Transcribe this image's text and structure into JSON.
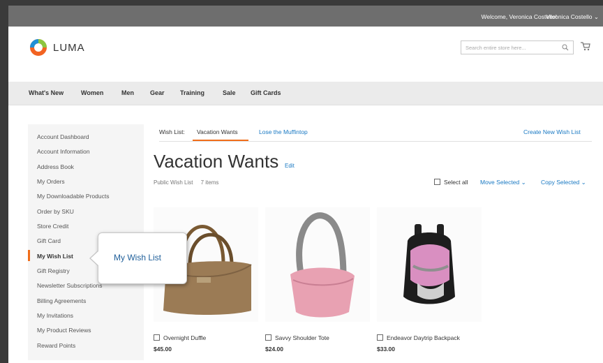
{
  "topbar": {
    "welcome": "Welcome, Veronica Costello!",
    "user_menu": "Veronica Costello"
  },
  "logo": {
    "text": "LUMA"
  },
  "search": {
    "placeholder": "Search entire store here..."
  },
  "nav": {
    "items": [
      "What's New",
      "Women",
      "Men",
      "Gear",
      "Training",
      "Sale",
      "Gift Cards"
    ]
  },
  "sidebar": {
    "items": [
      "Account Dashboard",
      "Account Information",
      "Address Book",
      "My Orders",
      "My Downloadable Products",
      "Order by SKU",
      "Store Credit",
      "Gift Card",
      "My Wish List",
      "Gift Registry",
      "Newsletter Subscriptions",
      "Billing Agreements",
      "My Invitations",
      "My Product Reviews",
      "Reward Points"
    ],
    "active": "My Wish List"
  },
  "tabs": {
    "prefix": "Wish List:",
    "active": "Vacation Wants",
    "other": "Lose the Muffintop",
    "create": "Create New Wish List"
  },
  "wishlist": {
    "title": "Vacation Wants",
    "edit": "Edit",
    "visibility": "Public Wish List",
    "count": "7 items"
  },
  "actions": {
    "select_all": "Select all",
    "move": "Move Selected",
    "copy": "Copy Selected"
  },
  "products": [
    {
      "name": "Overnight Duffle",
      "price": "$45.00"
    },
    {
      "name": "Savvy Shoulder Tote",
      "price": "$24.00"
    },
    {
      "name": "Endeavor Daytrip Backpack",
      "price": "$33.00"
    }
  ],
  "callout": {
    "text": "My Wish List"
  },
  "colors": {
    "accent": "#f06d1a",
    "link": "#1979c3",
    "topbar": "#6e6e6e"
  }
}
